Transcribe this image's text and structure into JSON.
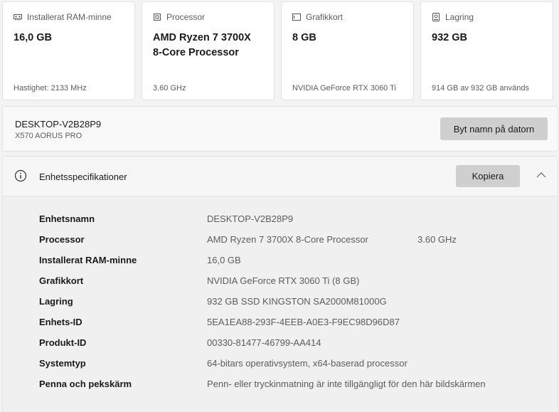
{
  "cards": [
    {
      "title": "Installerat RAM-minne",
      "icon": "ram-icon",
      "value_lines": [
        "16,0 GB"
      ],
      "footer": "Hastighet: 2133 MHz"
    },
    {
      "title": "Processor",
      "icon": "cpu-icon",
      "value_lines": [
        "AMD Ryzen 7 3700X",
        "8-Core Processor"
      ],
      "footer": "3.60 GHz"
    },
    {
      "title": "Grafikkort",
      "icon": "gpu-icon",
      "value_lines": [
        "8 GB"
      ],
      "footer": "NVIDIA GeForce RTX 3060 Ti"
    },
    {
      "title": "Lagring",
      "icon": "storage-icon",
      "value_lines": [
        "932 GB"
      ],
      "footer": "914 GB av 932 GB används"
    }
  ],
  "device": {
    "name": "DESKTOP-V2B28P9",
    "model": "X570 AORUS PRO",
    "rename_label": "Byt namn på datorn"
  },
  "specs": {
    "title": "Enhetsspecifikationer",
    "copy_label": "Kopiera",
    "rows": [
      {
        "label": "Enhetsnamn",
        "value": "DESKTOP-V2B28P9",
        "extra": ""
      },
      {
        "label": "Processor",
        "value": "AMD Ryzen 7 3700X 8-Core Processor",
        "extra": "3.60 GHz"
      },
      {
        "label": "Installerat RAM-minne",
        "value": "16,0 GB",
        "extra": ""
      },
      {
        "label": "Grafikkort",
        "value": "NVIDIA GeForce RTX 3060 Ti (8 GB)",
        "extra": ""
      },
      {
        "label": "Lagring",
        "value": "932 GB SSD KINGSTON SA2000M81000G",
        "extra": ""
      },
      {
        "label": "Enhets-ID",
        "value": "5EA1EA88-293F-4EEB-A0E3-F9EC98D96D87",
        "extra": ""
      },
      {
        "label": "Produkt-ID",
        "value": "00330-81477-46799-AA414",
        "extra": ""
      },
      {
        "label": "Systemtyp",
        "value": "64-bitars operativsystem, x64-baserad processor",
        "extra": ""
      },
      {
        "label": "Penna och pekskärm",
        "value": "Penn- eller tryckinmatning är inte tillgängligt för den här bildskärmen",
        "extra": ""
      }
    ]
  }
}
